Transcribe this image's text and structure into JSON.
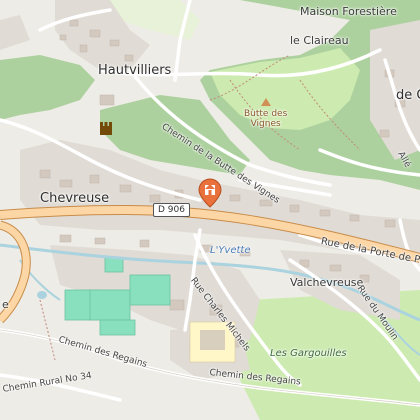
{
  "map": {
    "labels": {
      "maison_forestiere": "Maison Forestière",
      "le_claireau": "le Claireau",
      "hautvilliers": "Hautvilliers",
      "butte_des_vignes": "Butte des\nVignes",
      "chemin_butte": "Chemin de la Butte des Vignes",
      "chevreuse": "Chevreuse",
      "d906": "D 906",
      "rue_porte": "Rue de la Porte de P",
      "yvette": "L'Yvette",
      "rue_charles_michels": "Rue Charles Michels",
      "valchevreuse": "Valchevreuse",
      "rue_du_moulin": "Rue du Moulin",
      "chemin_regains_1": "Chemin des Regains",
      "chemin_regains_2": "Chemin des Regains",
      "chemin_rural": "Chemin Rural No 34",
      "gargouilles": "Les Gargouilles",
      "cut_right_top": "de C",
      "cut_right_mid": "Allé",
      "cut_left": "e"
    },
    "marker": {
      "type": "location-pin",
      "icon": "home-icon"
    },
    "colors": {
      "forest": "#add19e",
      "grass": "#c8e6b0",
      "residential": "#e1dcd6",
      "road_primary": "#fcd6a4",
      "road_primary_casing": "#c98c4a",
      "water": "#aad3df",
      "pitch": "#88e0be",
      "school": "#fffbd6",
      "pin": "#e8713c"
    }
  }
}
